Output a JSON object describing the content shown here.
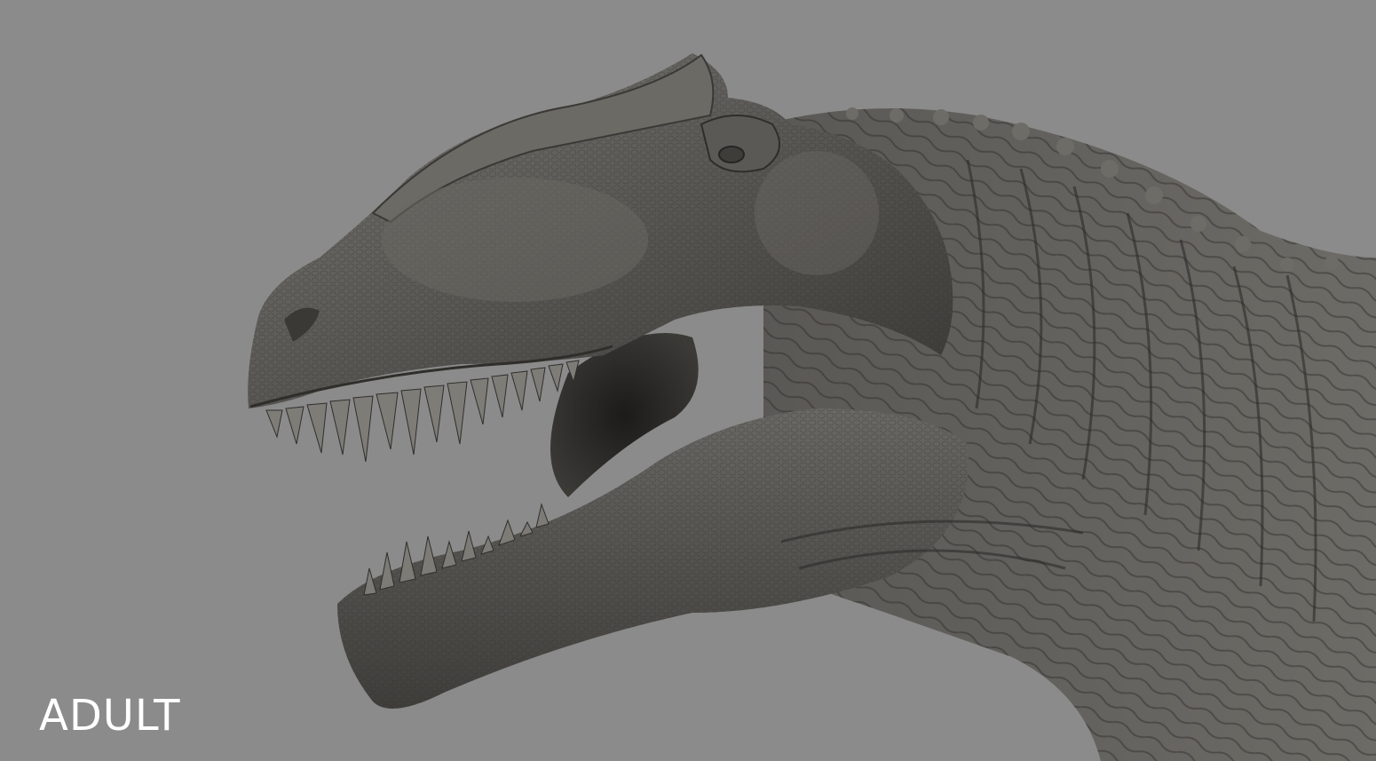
{
  "scene": {
    "subject": "dinosaur-head-sculpt",
    "background_color": "#8b8b8b",
    "skin_color": "#5e5c58"
  },
  "caption": {
    "label": "ADULT",
    "color": "#ffffff"
  }
}
